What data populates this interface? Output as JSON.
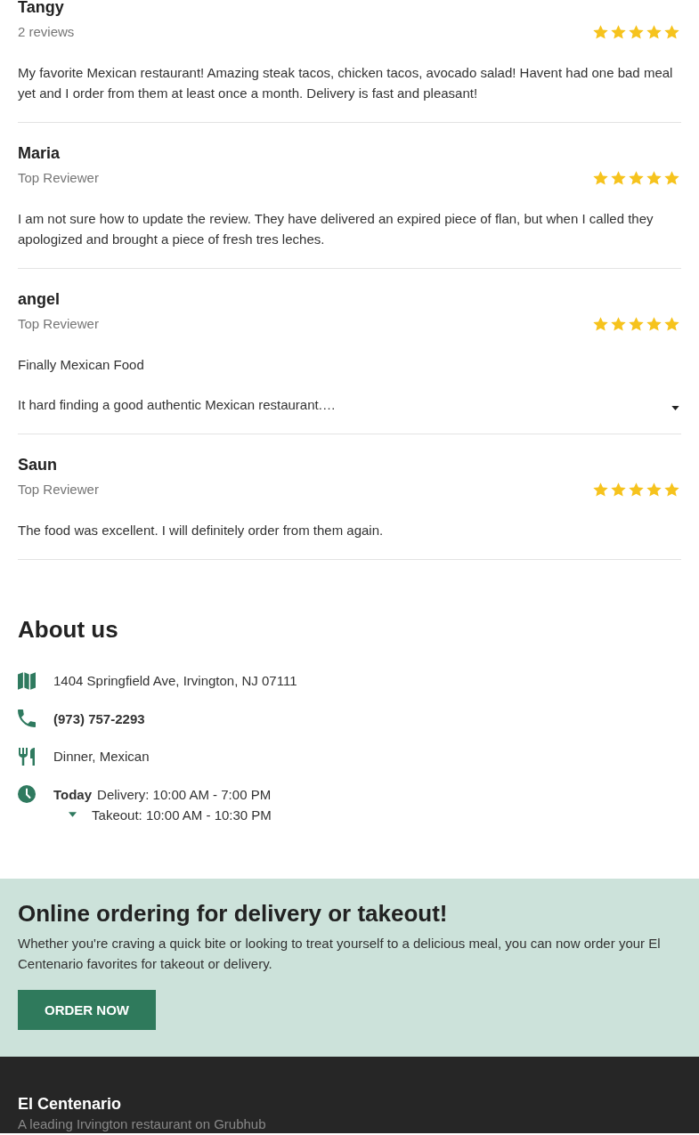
{
  "reviews": [
    {
      "name": "Tangy",
      "subtitle": "2 reviews",
      "stars": 5,
      "paragraphs": [
        "My favorite Mexican restaurant! Amazing steak tacos, chicken tacos, avocado salad! Havent had one bad meal yet and I order from them at least once a month. Delivery is fast and pleasant!"
      ],
      "expandable": false
    },
    {
      "name": "Maria",
      "subtitle": "Top Reviewer",
      "stars": 5,
      "paragraphs": [
        "I am not sure how to update the review. They have delivered an expired piece of flan, but when I called they apologized and brought a piece of fresh tres leches."
      ],
      "expandable": false
    },
    {
      "name": "angel",
      "subtitle": "Top Reviewer",
      "stars": 5,
      "paragraphs": [
        "Finally Mexican Food",
        "It hard finding a good authentic Mexican restaurant.…"
      ],
      "expandable": true
    },
    {
      "name": "Saun",
      "subtitle": "Top Reviewer",
      "stars": 5,
      "paragraphs": [
        "The food was excellent. I will definitely order from them again."
      ],
      "expandable": false
    }
  ],
  "about": {
    "heading": "About us",
    "items": [
      {
        "kind": "address",
        "text": "1404 Springfield Ave, Irvington, NJ 07111"
      },
      {
        "kind": "phone",
        "text": "(973) 757-2293"
      },
      {
        "kind": "categories",
        "text": "Dinner, Mexican"
      },
      {
        "kind": "hours",
        "day": "Today",
        "lines": [
          "Delivery: 10:00 AM - 7:00 PM",
          "Takeout: 10:00 AM - 10:30 PM"
        ],
        "expanded": false
      }
    ]
  },
  "promo": {
    "heading": "Online ordering for delivery or takeout!",
    "text": "Whether you're craving a quick bite or looking to treat yourself to a delicious meal, you can now order your El Centenario favorites for takeout or delivery.",
    "button": "ORDER NOW"
  },
  "footer": {
    "name": "El Centenario",
    "tagline": "A leading Irvington restaurant on Grubhub"
  }
}
